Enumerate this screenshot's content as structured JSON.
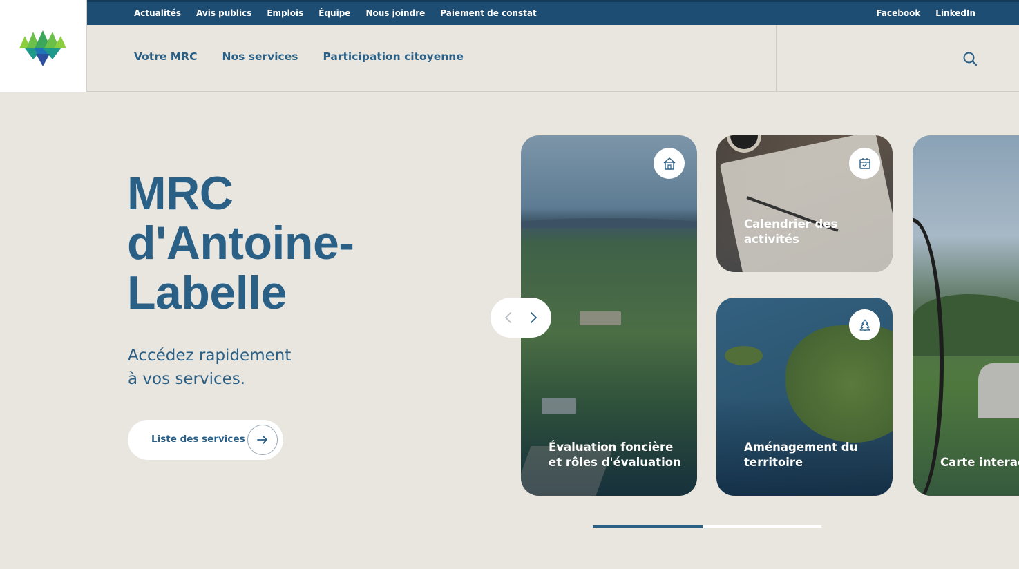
{
  "top_nav": {
    "links": [
      "Actualités",
      "Avis publics",
      "Emplois",
      "Équipe",
      "Nous joindre",
      "Paiement de constat"
    ],
    "social": [
      "Facebook",
      "LinkedIn"
    ]
  },
  "main_nav": {
    "items": [
      "Votre MRC",
      "Nos services",
      "Participation citoyenne"
    ]
  },
  "hero": {
    "title_lines": [
      "MRC",
      "d'Antoine-",
      "Labelle"
    ],
    "subtitle_lines": [
      "Accédez rapidement",
      "à vos services."
    ],
    "button_label": "Liste des services"
  },
  "cards": [
    {
      "label_lines": [
        "Évaluation foncière",
        "et rôles d'évaluation"
      ],
      "icon": "house-icon"
    },
    {
      "label_lines": [
        "Calendrier des",
        "activités"
      ],
      "icon": "calendar-check-icon"
    },
    {
      "label_lines": [
        "Aménagement du",
        "territoire"
      ],
      "icon": "pine-tree-icon"
    },
    {
      "label_lines": [
        "Carte interac"
      ],
      "icon": null
    }
  ],
  "carousel": {
    "progress": 0.48
  },
  "colors": {
    "brand_blue": "#2a5f86",
    "topbar": "#1d4d73",
    "background": "#e8e6df"
  }
}
